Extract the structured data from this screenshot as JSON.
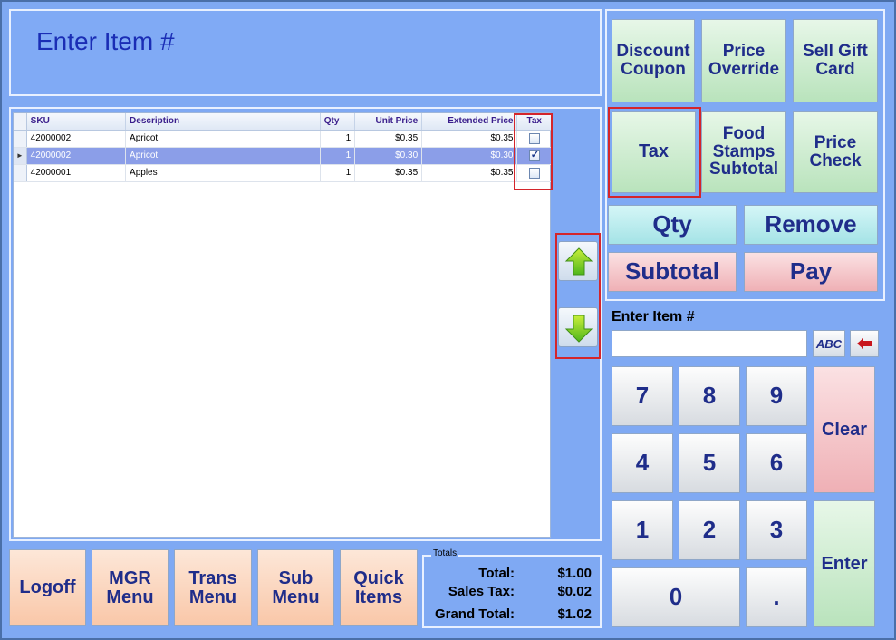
{
  "header": {
    "title": "Enter Item #"
  },
  "grid": {
    "columns": [
      "SKU",
      "Description",
      "Qty",
      "Unit Price",
      "Extended Price",
      "Tax"
    ],
    "rows": [
      {
        "sku": "42000002",
        "description": "Apricot",
        "qty": "1",
        "unit_price": "$0.35",
        "extended_price": "$0.35",
        "tax": false
      },
      {
        "sku": "42000002",
        "description": "Apricot",
        "qty": "1",
        "unit_price": "$0.30",
        "extended_price": "$0.30",
        "tax": true
      },
      {
        "sku": "42000001",
        "description": "Apples",
        "qty": "1",
        "unit_price": "$0.35",
        "extended_price": "$0.35",
        "tax": false
      }
    ],
    "selected_row": 1
  },
  "function_buttons": {
    "discount_coupon": "Discount Coupon",
    "price_override": "Price Override",
    "sell_gift_card": "Sell Gift Card",
    "tax": "Tax",
    "food_stamps_subtotal": "Food Stamps Subtotal",
    "price_check": "Price Check",
    "qty": "Qty",
    "remove": "Remove",
    "subtotal": "Subtotal",
    "pay": "Pay"
  },
  "entry": {
    "label": "Enter Item #",
    "value": "",
    "abc_label": "ABC"
  },
  "keypad": {
    "k7": "7",
    "k8": "8",
    "k9": "9",
    "k4": "4",
    "k5": "5",
    "k6": "6",
    "k1": "1",
    "k2": "2",
    "k3": "3",
    "k0": "0",
    "dot": ".",
    "clear": "Clear",
    "enter": "Enter"
  },
  "bottom_menu": {
    "logoff": "Logoff",
    "mgr_menu": "MGR Menu",
    "trans_menu": "Trans Menu",
    "sub_menu": "Sub Menu",
    "quick_items": "Quick Items"
  },
  "totals": {
    "legend": "Totals",
    "total_label": "Total:",
    "total_value": "$1.00",
    "sales_tax_label": "Sales Tax:",
    "sales_tax_value": "$0.02",
    "grand_total_label": "Grand Total:",
    "grand_total_value": "$1.02"
  },
  "icons": {
    "up": "arrow-up-icon",
    "down": "arrow-down-icon",
    "backspace": "backspace-arrow-icon"
  },
  "colors": {
    "background": "#7fa9f3",
    "highlight_border": "#d4252b",
    "selected_row": "#8b9ee8",
    "header_text": "#1a2db5"
  }
}
